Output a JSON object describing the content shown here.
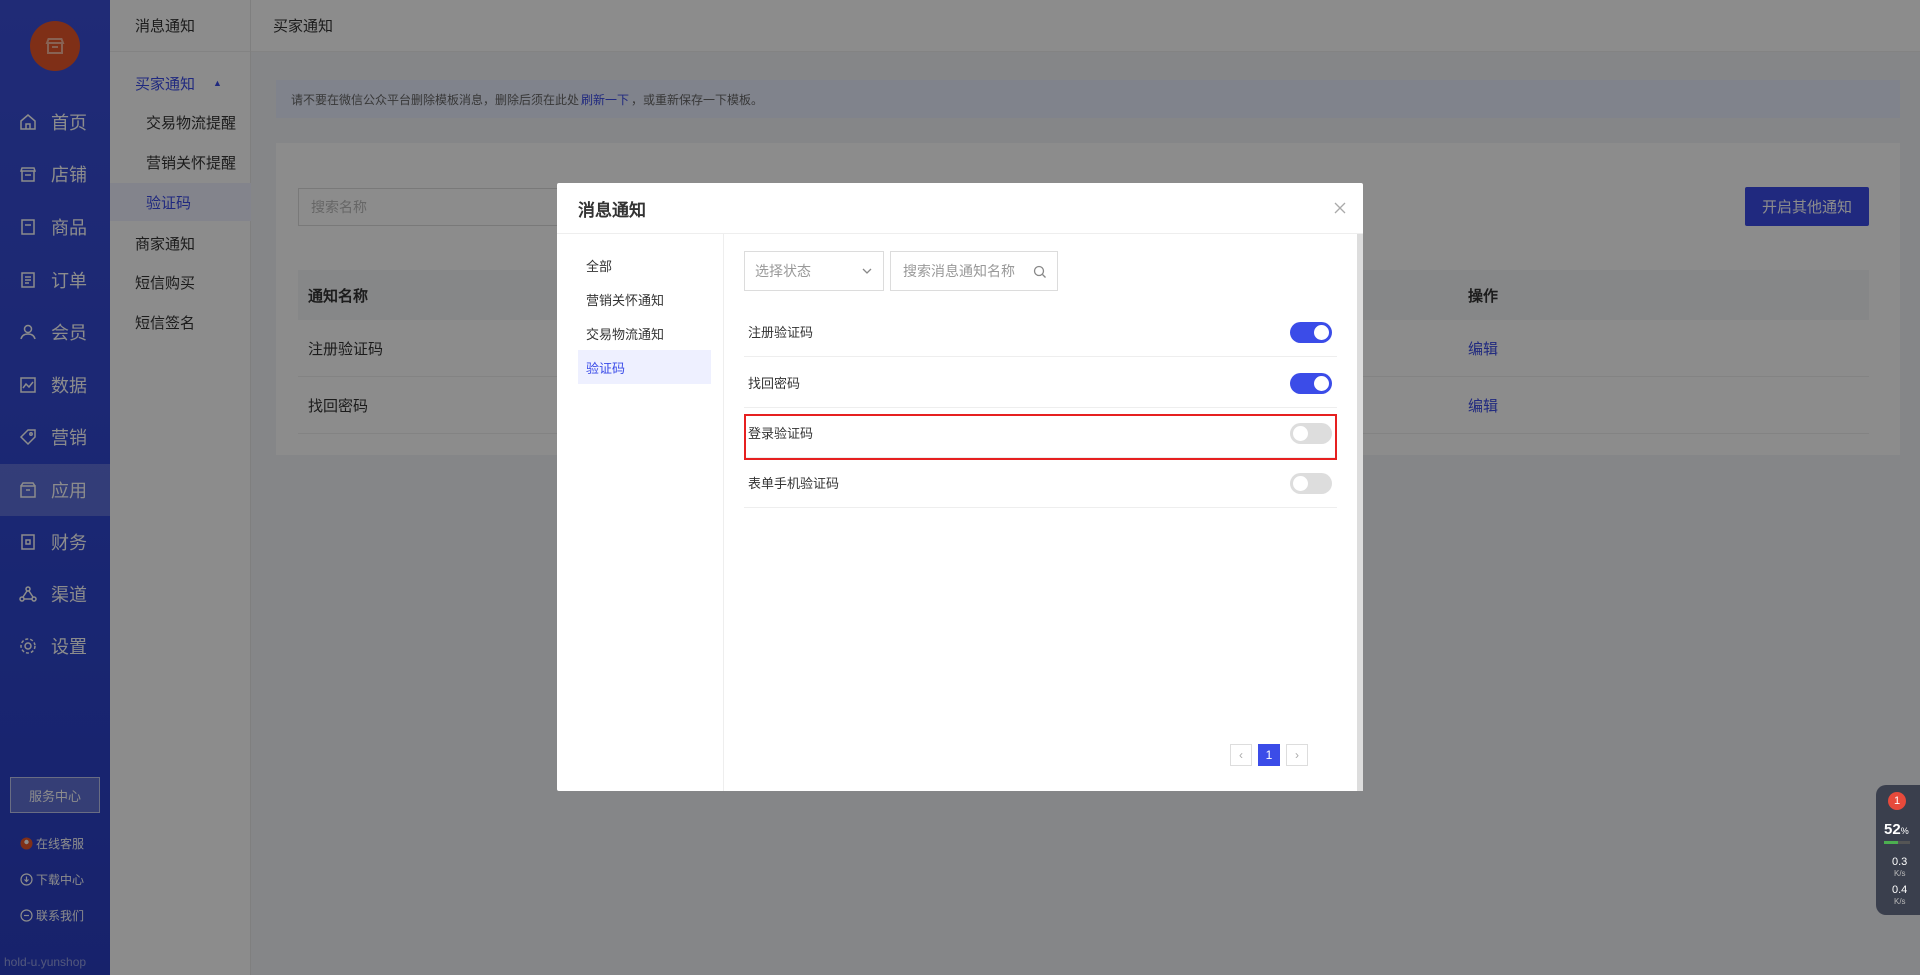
{
  "nav": {
    "items": [
      {
        "label": "首页",
        "icon": "home-icon"
      },
      {
        "label": "店铺",
        "icon": "store-icon"
      },
      {
        "label": "商品",
        "icon": "goods-icon"
      },
      {
        "label": "订单",
        "icon": "order-icon"
      },
      {
        "label": "会员",
        "icon": "member-icon"
      },
      {
        "label": "数据",
        "icon": "chart-icon"
      },
      {
        "label": "营销",
        "icon": "tag-icon"
      },
      {
        "label": "应用",
        "icon": "app-icon"
      },
      {
        "label": "财务",
        "icon": "finance-icon"
      },
      {
        "label": "渠道",
        "icon": "channel-icon"
      },
      {
        "label": "设置",
        "icon": "gear-icon"
      }
    ],
    "active": "应用",
    "service_center": "服务中心",
    "links": [
      "在线客服",
      "下载中心",
      "联系我们"
    ],
    "footer": "hold-u.yunshop"
  },
  "subnav": {
    "title": "消息通知",
    "group_buyer": "买家通知",
    "buyer_items": [
      "交易物流提醒",
      "营销关怀提醒",
      "验证码"
    ],
    "other_items": [
      "商家通知",
      "短信购买",
      "短信签名"
    ]
  },
  "topbar": {
    "title": "买家通知"
  },
  "notice": {
    "prefix": "请不要在微信公众平台删除模板消息，删除后须在此处",
    "link": "刷新一下",
    "suffix": "，或重新保存一下模板。"
  },
  "card": {
    "search_placeholder": "搜索名称",
    "open_button": "开启其他通知",
    "columns": {
      "name": "通知名称",
      "action": "操作"
    },
    "rows": [
      {
        "name": "注册验证码",
        "action": "编辑"
      },
      {
        "name": "找回密码",
        "action": "编辑"
      }
    ]
  },
  "dialog": {
    "title": "消息通知",
    "categories": [
      "全部",
      "营销关怀通知",
      "交易物流通知",
      "验证码"
    ],
    "active_category": "验证码",
    "status_placeholder": "选择状态",
    "search_placeholder": "搜索消息通知名称",
    "options": [
      {
        "name": "注册验证码",
        "enabled": true
      },
      {
        "name": "找回密码",
        "enabled": true
      },
      {
        "name": "登录验证码",
        "enabled": false
      },
      {
        "name": "表单手机验证码",
        "enabled": false
      }
    ],
    "page": "1",
    "accent": "#3b4ce8",
    "highlight_color": "#e62020"
  },
  "perf": {
    "badge": "1",
    "cpu": "52",
    "cpu_unit": "%",
    "cpu_fraction": 0.52,
    "up": "0.3",
    "down": "0.4",
    "speed_unit": "K/s"
  }
}
